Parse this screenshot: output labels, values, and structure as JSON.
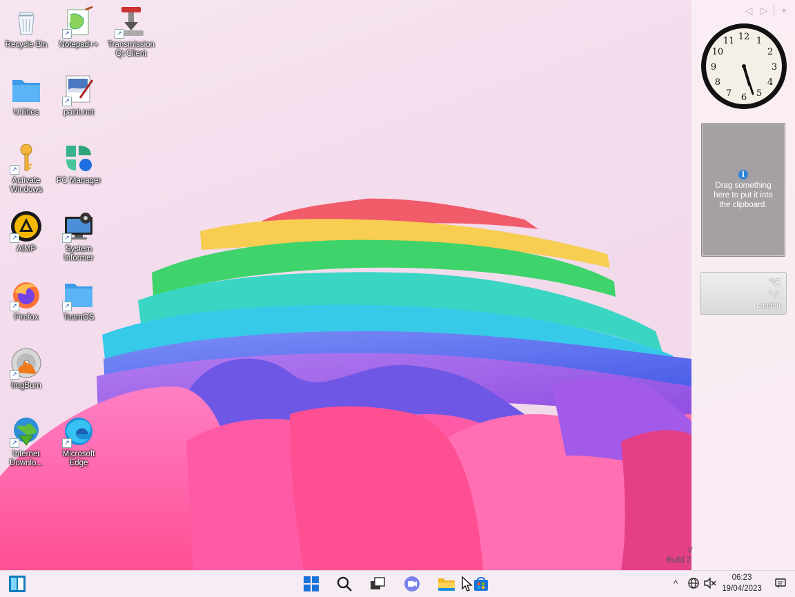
{
  "desktop": {
    "icons": [
      {
        "label": "Recycle Bin"
      },
      {
        "label": "Notepad++"
      },
      {
        "label": "Transmission Qt Client"
      },
      {
        "label": "Utilities"
      },
      {
        "label": "paint.net"
      },
      {
        "label": "Activate Windows"
      },
      {
        "label": "PC Manager"
      },
      {
        "label": "AIMP"
      },
      {
        "label": "System Informer"
      },
      {
        "label": "Firefox"
      },
      {
        "label": "TeamOS"
      },
      {
        "label": "ImgBurn"
      },
      {
        "label": "Internet Downlo..."
      },
      {
        "label": "Microsoft Edge"
      }
    ],
    "shortcut_arrow": "↗",
    "build_v": "V",
    "build_text": "Build 2"
  },
  "sidebar": {
    "nav": {
      "prev": "◁",
      "next": "▷",
      "add": "+"
    },
    "clock": {
      "hour": 5,
      "minute": 27,
      "numbers": [
        "12",
        "1",
        "2",
        "3",
        "4",
        "5",
        "6",
        "7",
        "8",
        "9",
        "10",
        "11"
      ]
    },
    "clipboard": {
      "info": "i",
      "text": "Drag something here to put it into the clipboard."
    },
    "weather": {
      "temp": "°C",
      "range": "° /°",
      "city": "London"
    }
  },
  "taskbar": {
    "time": "06:23",
    "date": "19/04/2023",
    "tray_chevron": "^"
  }
}
